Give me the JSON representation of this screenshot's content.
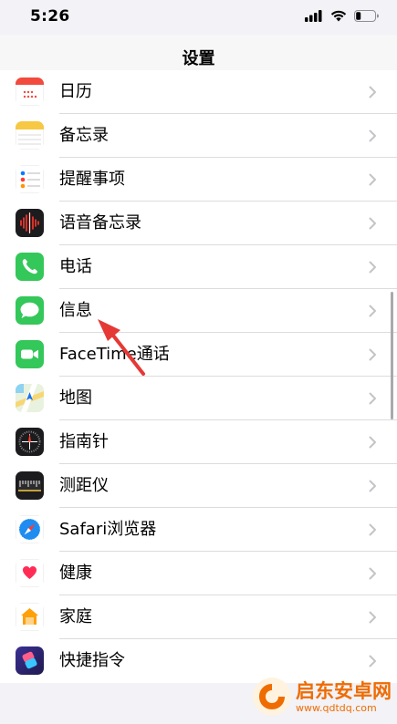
{
  "status": {
    "time": "5:26"
  },
  "nav": {
    "title": "设置"
  },
  "rows": [
    {
      "label": "日历",
      "icon": "calendar-icon"
    },
    {
      "label": "备忘录",
      "icon": "notes-icon"
    },
    {
      "label": "提醒事项",
      "icon": "reminders-icon"
    },
    {
      "label": "语音备忘录",
      "icon": "voice-memos-icon"
    },
    {
      "label": "电话",
      "icon": "phone-icon"
    },
    {
      "label": "信息",
      "icon": "messages-icon"
    },
    {
      "label": "FaceTime通话",
      "icon": "facetime-icon"
    },
    {
      "label": "地图",
      "icon": "maps-icon"
    },
    {
      "label": "指南针",
      "icon": "compass-icon"
    },
    {
      "label": "测距仪",
      "icon": "measure-icon"
    },
    {
      "label": "Safari浏览器",
      "icon": "safari-icon"
    },
    {
      "label": "健康",
      "icon": "health-icon"
    },
    {
      "label": "家庭",
      "icon": "home-icon"
    },
    {
      "label": "快捷指令",
      "icon": "shortcuts-icon"
    }
  ],
  "watermark": {
    "title": "启东安卓网",
    "url": "www.qdtdq.com"
  },
  "colors": {
    "accent": "#34c759",
    "arrow": "#e53935",
    "watermark": "#ef6c00"
  }
}
